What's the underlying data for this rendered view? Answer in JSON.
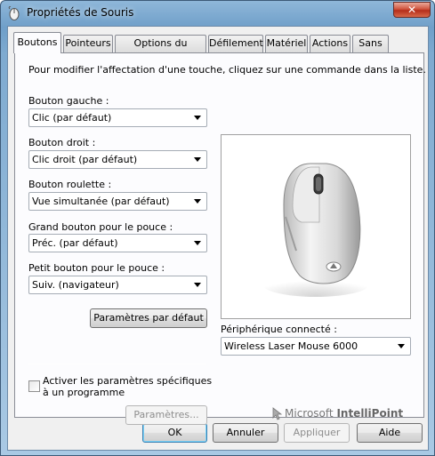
{
  "window": {
    "title": "Propriétés de Souris",
    "close_label": "✕"
  },
  "tabs": [
    {
      "label": "Boutons",
      "active": true
    },
    {
      "label": "Pointeurs"
    },
    {
      "label": "Options du pointeur"
    },
    {
      "label": "Défilement"
    },
    {
      "label": "Matériel"
    },
    {
      "label": "Actions"
    },
    {
      "label": "Sans fil"
    }
  ],
  "panel": {
    "instructions": "Pour modifier l'affectation d'une touche, cliquez sur une commande dans la liste.",
    "fields": [
      {
        "label": "Bouton gauche :",
        "value": "Clic (par défaut)"
      },
      {
        "label": "Bouton droit :",
        "value": "Clic droit (par défaut)"
      },
      {
        "label": "Bouton roulette :",
        "value": "Vue simultanée (par défaut)"
      },
      {
        "label": "Grand bouton pour le pouce :",
        "value": "Préc. (par défaut)"
      },
      {
        "label": "Petit bouton pour le pouce :",
        "value": "Suiv. (navigateur)"
      }
    ],
    "defaults_button": "Paramètres par défaut",
    "device_label": "Périphérique connecté :",
    "device_value": "Wireless Laser Mouse 6000",
    "app_specific_checkbox": "Activer les paramètres spécifiques à un programme",
    "app_specific_checked": false,
    "settings_button": "Paramètres...",
    "brand_microsoft": "Microsoft",
    "brand_product": "IntelliPoint"
  },
  "footer": {
    "ok": "OK",
    "cancel": "Annuler",
    "apply": "Appliquer",
    "help": "Aide"
  },
  "colors": {
    "titlebar": "#7eaad0",
    "close": "#c8442e",
    "dialog_bg": "#f0f0f0",
    "panel_bg": "#fcfcfe"
  }
}
